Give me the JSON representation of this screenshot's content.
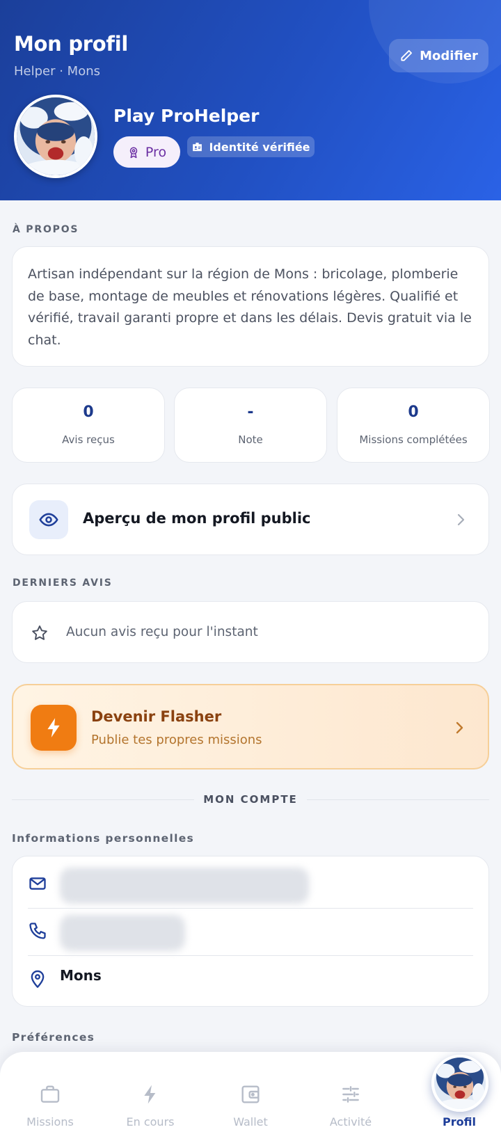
{
  "header": {
    "title": "Mon profil",
    "subtitle": "Helper · Mons",
    "edit_label": "Modifier",
    "user_name": "Play ProHelper",
    "pro_badge": "Pro",
    "verified_badge": "Identité vérifiée"
  },
  "about": {
    "label": "À PROPOS",
    "text": "Artisan indépendant sur la région de Mons : bricolage, plomberie de base, montage de meubles et rénovations légères. Qualifié et vérifié, travail garanti propre et dans les délais. Devis gratuit via le chat."
  },
  "stats": [
    {
      "value": "0",
      "label": "Avis reçus"
    },
    {
      "value": "-",
      "label": "Note"
    },
    {
      "value": "0",
      "label": "Missions complétées"
    }
  ],
  "preview": {
    "label": "Aperçu de mon profil public",
    "icon": "eye-icon"
  },
  "reviews": {
    "label": "DERNIERS AVIS",
    "empty_text": "Aucun avis reçu pour l'instant",
    "icon": "star-icon"
  },
  "flasher": {
    "title": "Devenir Flasher",
    "subtitle": "Publie tes propres missions",
    "icon": "lightning-icon",
    "accent": "#f07c12"
  },
  "account": {
    "label": "MON COMPTE",
    "personal_info_heading": "Informations personnelles",
    "email_value": "",
    "phone_value": "",
    "location_value": "Mons",
    "preferences_heading": "Préférences"
  },
  "nav": {
    "items": [
      {
        "label": "Missions",
        "icon": "briefcase-icon"
      },
      {
        "label": "En cours",
        "icon": "lightning-icon"
      },
      {
        "label": "Wallet",
        "icon": "wallet-icon"
      },
      {
        "label": "Activité",
        "icon": "sliders-icon"
      },
      {
        "label": "Profil",
        "icon": "avatar"
      }
    ],
    "active": "Profil"
  },
  "colors": {
    "brand": "#1f3f9a",
    "header_gradient_start": "#1b3f9a",
    "header_gradient_end": "#2a62e6",
    "pro_text": "#6b2fa3"
  }
}
